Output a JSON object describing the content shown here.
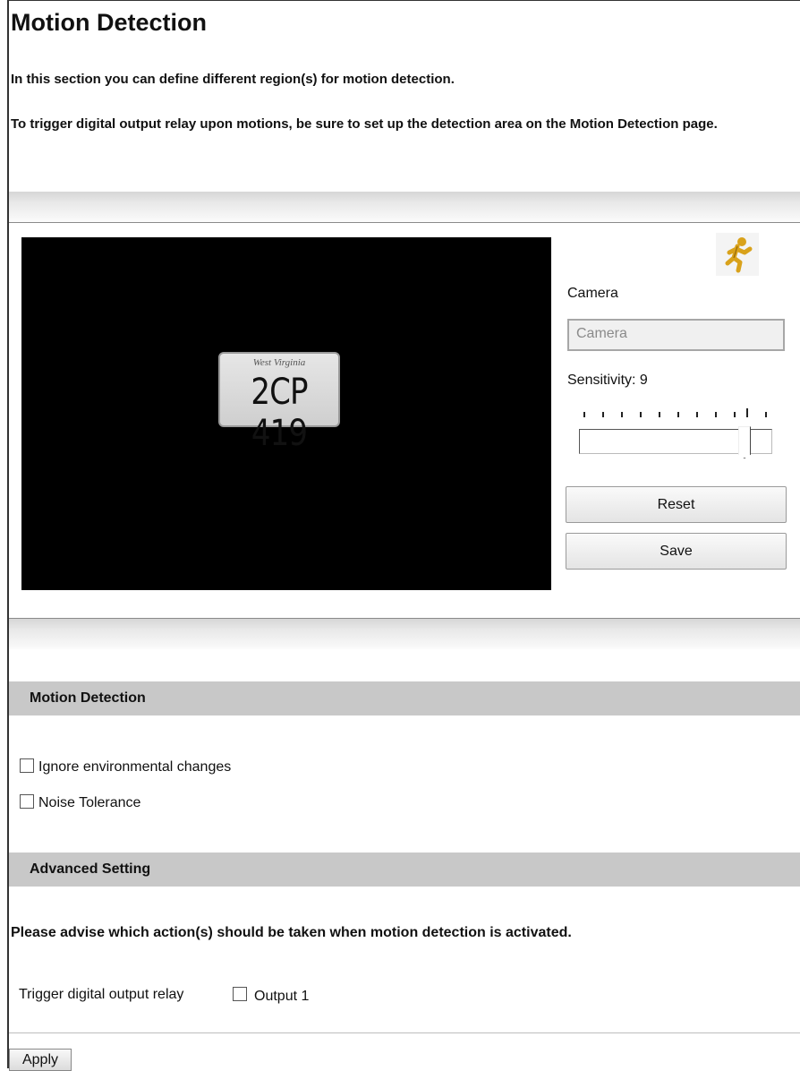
{
  "page": {
    "title": "Motion Detection",
    "intro": "In this section you can define different region(s) for motion detection.",
    "note": "To trigger digital output relay upon motions, be sure to set up the detection area on the Motion Detection page."
  },
  "video": {
    "plate_state": "West Virginia",
    "plate_number": "2CP 419"
  },
  "controls": {
    "camera_label": "Camera",
    "camera_selected": "Camera",
    "sensitivity_label": "Sensitivity: 9",
    "sensitivity_value": 9,
    "reset_label": "Reset",
    "save_label": "Save",
    "runner_icon": "running-man-icon"
  },
  "motion_section": {
    "heading": "Motion Detection",
    "options": [
      {
        "label": "Ignore environmental changes",
        "checked": false
      },
      {
        "label": "Noise Tolerance",
        "checked": false
      }
    ]
  },
  "advanced_section": {
    "heading": "Advanced Setting",
    "advise": "Please advise which action(s) should be taken when motion detection is activated.",
    "trigger_label": "Trigger digital output relay",
    "output_label": "Output 1",
    "output_checked": false
  },
  "apply_label": "Apply"
}
